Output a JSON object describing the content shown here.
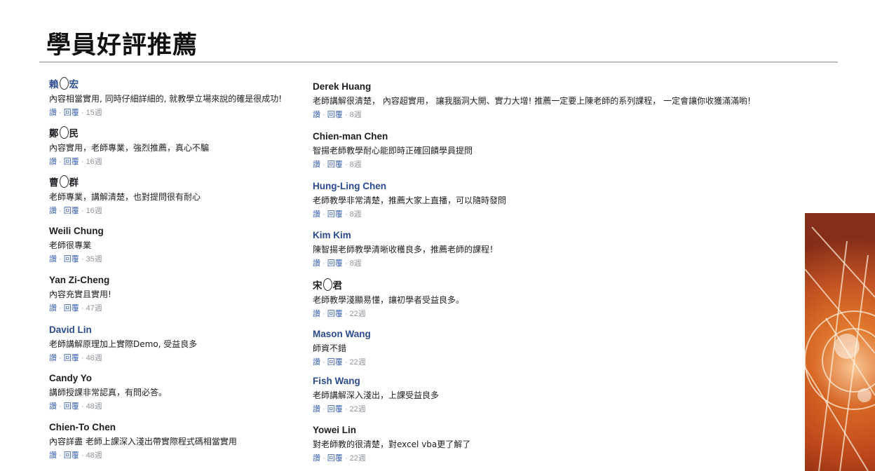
{
  "page": {
    "title": "學員好評推薦"
  },
  "meta_labels": {
    "like": "讚",
    "reply": "回覆",
    "sep": "·"
  },
  "left_comments": [
    {
      "author_a": "賴",
      "author_b": "宏",
      "text": "內容相當實用, 同時仔細詳細的, 就教學立場來說的確是很成功!",
      "age": "15週",
      "style": "blue",
      "masked": true
    },
    {
      "author_a": "鄭",
      "author_b": "民",
      "text": "內容實用，老師專業，強烈推薦，真心不騙",
      "age": "16週",
      "style": "black",
      "masked": true
    },
    {
      "author_a": "曹",
      "author_b": "群",
      "text": "老師專業，講解清楚，也對提問很有耐心",
      "age": "16週",
      "style": "black",
      "masked": true
    },
    {
      "author": "Weili Chung",
      "text": "老師很專業",
      "age": "35週",
      "style": "black",
      "masked": false
    },
    {
      "author": "Yan Zi-Cheng",
      "text": "內容充實且實用!",
      "age": "47週",
      "style": "black",
      "masked": false
    },
    {
      "author": "David Lin",
      "text": "老師講解原理加上實際Demo, 受益良多",
      "age": "48週",
      "style": "blue",
      "masked": false
    },
    {
      "author": "Candy Yo",
      "text": "講師授課非常認真，有問必答。",
      "age": "48週",
      "style": "black",
      "masked": false
    },
    {
      "author": "Chien-To Chen",
      "text": "內容詳盡 老師上課深入淺出帶實際程式碼相當實用",
      "age": "48週",
      "style": "black",
      "masked": false
    }
  ],
  "right_comments": [
    {
      "author": "Derek Huang",
      "text": "老師講解很清楚， 內容超實用， 讓我腦洞大開、實力大增! 推薦一定要上陳老師的系列課程， 一定會讓你收獲滿滿喲!",
      "age": "8週",
      "style": "black",
      "masked": false
    },
    {
      "author": "Chien-man Chen",
      "text": "智揚老師教學耐心能即時正確回饋學員提問",
      "age": "8週",
      "style": "black",
      "masked": false
    },
    {
      "author": "Hung-Ling Chen",
      "text": "老師教學非常清楚，推薦大家上直播，可以隨時發問",
      "age": "8週",
      "style": "blue",
      "masked": false
    },
    {
      "author": "Kim Kim",
      "text": "陳智揚老師教學清晰收穫良多，推薦老師的課程！",
      "age": "8週",
      "style": "blue",
      "masked": false
    },
    {
      "author_a": "宋",
      "author_b": "君",
      "text": "老師教學淺顯易懂，讓初學者受益良多。",
      "age": "22週",
      "style": "black",
      "masked": true
    },
    {
      "author": "Mason Wang",
      "text": "師資不錯",
      "age": "22週",
      "style": "blue",
      "masked": false
    },
    {
      "author": "Fish Wang",
      "text": "老師講解深入淺出，上課受益良多",
      "age": "22週",
      "style": "blue",
      "masked": false
    },
    {
      "author": "Yowei Lin",
      "text": "對老師教的很清楚，對excel vba更了解了",
      "age": "22週",
      "style": "black",
      "masked": false
    }
  ]
}
